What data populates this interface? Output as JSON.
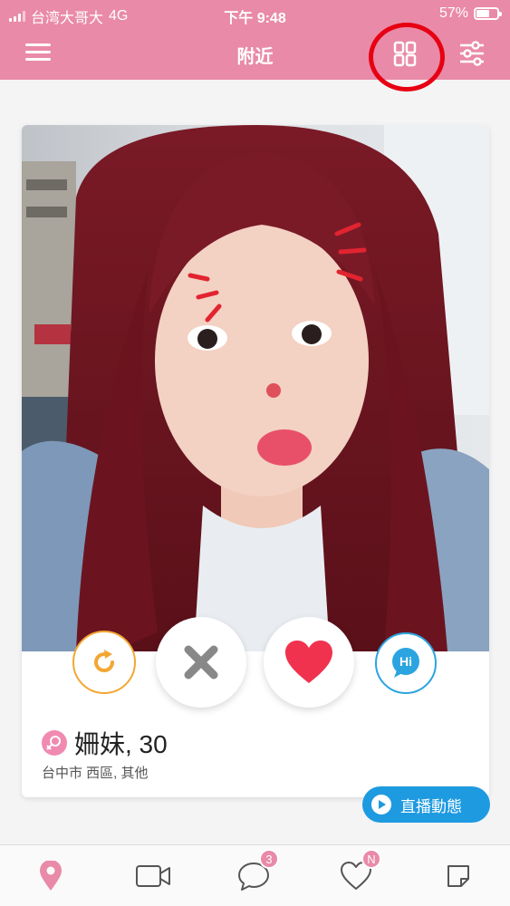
{
  "status_bar": {
    "carrier": "台湾大哥大",
    "network": "4G",
    "time": "下午 9:48",
    "battery": "57%",
    "battery_level": 0.57
  },
  "header": {
    "title": "附近",
    "menu_icon": "hamburger-icon",
    "grid_icon": "grid-view-icon",
    "filter_icon": "sliders-icon",
    "header_color": "#e98aa8"
  },
  "profile": {
    "name_age": "姍妹, 30",
    "location": "台中市 西區, 其他",
    "gender_icon": "female-icon"
  },
  "actions": {
    "rewind_icon": "rewind-icon",
    "nope_icon": "x-icon",
    "like_icon": "heart-icon",
    "hi_label": "Hi"
  },
  "live_button": {
    "label": "直播動態",
    "color": "#1e9ae0"
  },
  "bottom_nav": {
    "items": [
      {
        "icon": "location-pin-icon",
        "badge": ""
      },
      {
        "icon": "video-camera-icon",
        "badge": ""
      },
      {
        "icon": "chat-bubble-icon",
        "badge": "3"
      },
      {
        "icon": "heart-outline-icon",
        "badge": "N"
      },
      {
        "icon": "note-icon",
        "badge": ""
      }
    ]
  },
  "colors": {
    "accent": "#e98aa8",
    "rewind": "#f2a733",
    "nope": "#888888",
    "like": "#f0324f",
    "hi": "#2ba4e0",
    "highlight_ring": "#e60012"
  }
}
